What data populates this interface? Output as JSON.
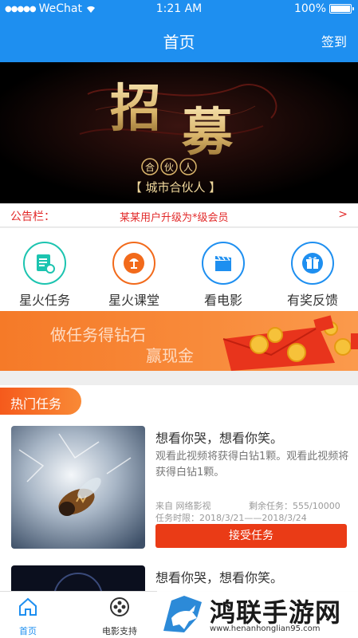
{
  "status_bar": {
    "carrier": "WeChat",
    "signal": "●●●●●",
    "time": "1:21 AM",
    "battery": "100%",
    "battery_level": 1.0
  },
  "nav": {
    "title": "首页",
    "signin_label": "签到"
  },
  "banner": {
    "char1": "招",
    "char2": "募",
    "badge_chars": [
      "合",
      "伙",
      "人"
    ],
    "subtitle": "【 城市合伙人 】"
  },
  "notice": {
    "label": "公告栏：",
    "text": "某某用户升级为*级会员",
    "arrow": ">"
  },
  "menu": {
    "items": [
      {
        "label": "星火任务",
        "icon": "task-icon",
        "color": "#1cc4b0"
      },
      {
        "label": "星火课堂",
        "icon": "lamp-icon",
        "color": "#f26a1b"
      },
      {
        "label": "看电影",
        "icon": "clapperboard-icon",
        "color": "#1e8ff0"
      },
      {
        "label": "有奖反馈",
        "icon": "gift-icon",
        "color": "#1e8ff0"
      }
    ]
  },
  "promo": {
    "line1": "做任务得钻石",
    "line2": "赢现金"
  },
  "hot": {
    "tag": "热门任务",
    "tasks": [
      {
        "title": "想看你哭，想看你笑。",
        "desc": "观看此视频将获得白钻1颗。观看此视频将获得白钻1颗。",
        "source": "来自 网络影视",
        "remaining": "剩余任务：555/10000",
        "period": "任务时限：2018/3/21——2018/3/24",
        "button": "接受任务"
      },
      {
        "title": "想看你哭，想看你笑。"
      }
    ]
  },
  "tabbar": {
    "items": [
      {
        "label": "首页",
        "icon": "home-icon",
        "active": true
      },
      {
        "label": "电影支持",
        "icon": "film-reel-icon",
        "active": false
      }
    ],
    "active_color": "#1e8ff0",
    "inactive_color": "#333333"
  },
  "watermark": {
    "title": "鸿联手游网",
    "url": "www.henanhonglian95.com"
  }
}
